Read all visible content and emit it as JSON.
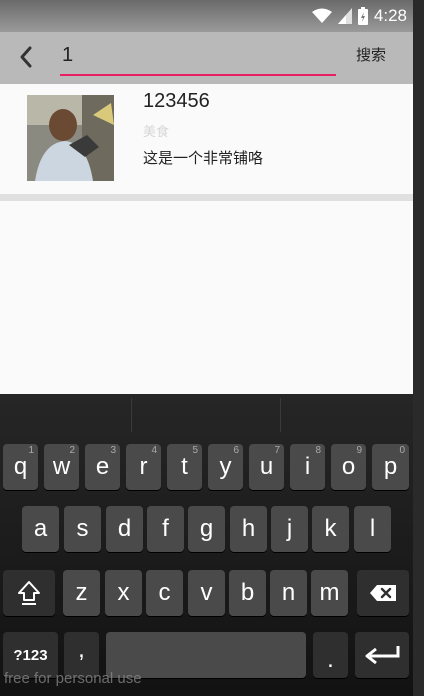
{
  "status_bar": {
    "time": "4:28",
    "icons": [
      "wifi-icon",
      "signal-icon",
      "battery-icon"
    ]
  },
  "search_bar": {
    "back_icon": "arrow-left-icon",
    "query": "1",
    "search_label": "搜索",
    "accent_color": "#e91e63"
  },
  "results": [
    {
      "title": "123456",
      "category": "美食",
      "description": "这是一个非常铺咯"
    }
  ],
  "keyboard": {
    "row1": [
      {
        "label": "q",
        "hint": "1"
      },
      {
        "label": "w",
        "hint": "2"
      },
      {
        "label": "e",
        "hint": "3"
      },
      {
        "label": "r",
        "hint": "4"
      },
      {
        "label": "t",
        "hint": "5"
      },
      {
        "label": "y",
        "hint": "6"
      },
      {
        "label": "u",
        "hint": "7"
      },
      {
        "label": "i",
        "hint": "8"
      },
      {
        "label": "o",
        "hint": "9"
      },
      {
        "label": "p",
        "hint": "0"
      }
    ],
    "row2": [
      {
        "label": "a"
      },
      {
        "label": "s"
      },
      {
        "label": "d"
      },
      {
        "label": "f"
      },
      {
        "label": "g"
      },
      {
        "label": "h"
      },
      {
        "label": "j"
      },
      {
        "label": "k"
      },
      {
        "label": "l"
      }
    ],
    "row3": [
      {
        "label": "z"
      },
      {
        "label": "x"
      },
      {
        "label": "c"
      },
      {
        "label": "v"
      },
      {
        "label": "b"
      },
      {
        "label": "n"
      },
      {
        "label": "m"
      }
    ],
    "symbols_label": "?123",
    "comma_label": ",",
    "period_label": "."
  },
  "watermark": "free for personal use"
}
